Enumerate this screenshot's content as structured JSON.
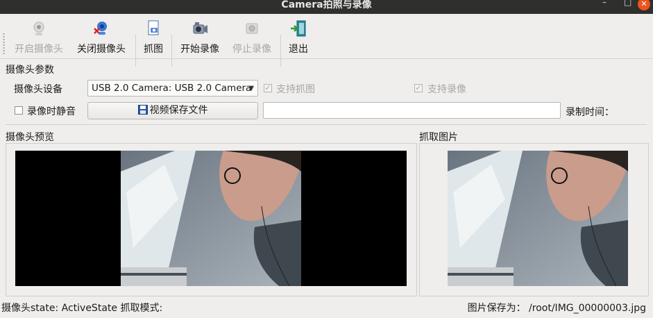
{
  "window": {
    "title": "Camera拍照与录像",
    "minimize_glyph": "–",
    "maximize_glyph": "□",
    "close_glyph": "✕"
  },
  "toolbar": {
    "open_camera": "开启摄像头",
    "close_camera": "关闭摄像头",
    "capture": "抓图",
    "start_record": "开始录像",
    "stop_record": "停止录像",
    "exit": "退出"
  },
  "params": {
    "group_title": "摄像头参数",
    "device_label": "摄像头设备",
    "device_value": "USB 2.0 Camera: USB 2.0 Camera",
    "support_capture": "支持抓图",
    "support_record": "支持录像",
    "mute_label": "录像时静音",
    "save_file_button": "视频保存文件",
    "save_path_value": "",
    "record_time_label": "录制时间："
  },
  "preview": {
    "title": "摄像头预览"
  },
  "capture_panel": {
    "title": "抓取图片"
  },
  "statusbar": {
    "left": "摄像头state: ActiveState  抓取模式:",
    "right": "图片保存为： /root/IMG_00000003.jpg"
  },
  "icons": {
    "open_camera": "webcam-icon",
    "close_camera": "webcam-off-icon",
    "capture": "camera-capture-icon",
    "start_record": "video-camera-icon",
    "stop_record": "stop-record-icon",
    "exit": "exit-door-icon",
    "save": "floppy-disk-icon",
    "dropdown": "chevron-down-icon"
  },
  "colors": {
    "titlebar": "#2f2f2d",
    "close_button": "#e95420",
    "window_bg": "#efeeec",
    "preview_black": "#000000"
  }
}
